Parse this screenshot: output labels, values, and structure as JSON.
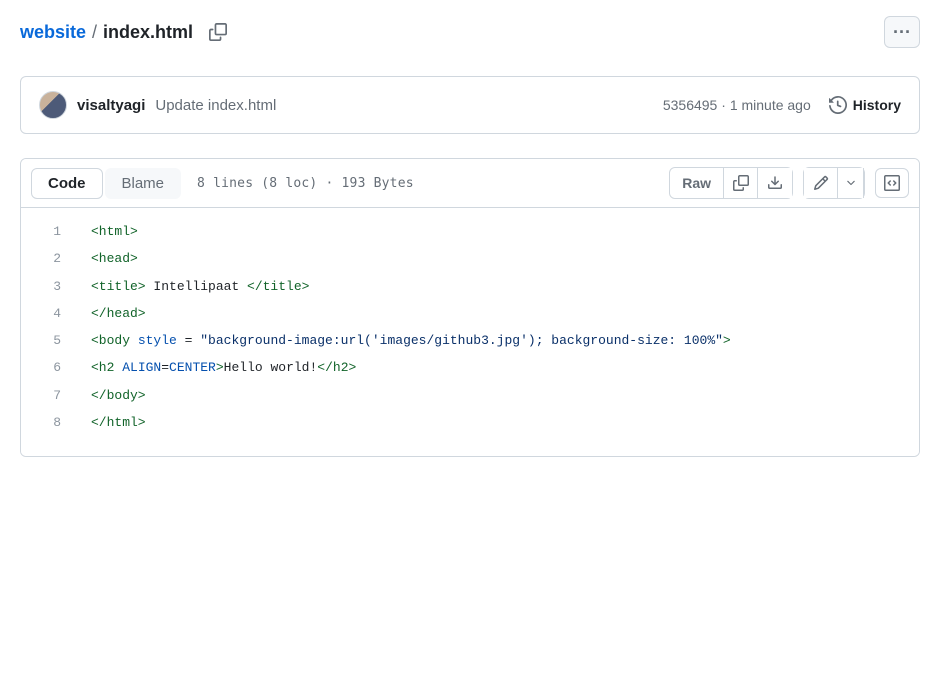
{
  "breadcrumb": {
    "dir": "website",
    "file": "index.html"
  },
  "commit": {
    "author": "visaltyagi",
    "message": "Update index.html",
    "sha": "5356495",
    "time": "1 minute ago",
    "history_label": "History"
  },
  "toolbar": {
    "code_label": "Code",
    "blame_label": "Blame",
    "stats": "8 lines (8 loc) · 193 Bytes",
    "raw_label": "Raw"
  },
  "code_lines": [
    {
      "n": "1",
      "tokens": [
        {
          "c": "pl-ent",
          "t": "<html>"
        }
      ]
    },
    {
      "n": "2",
      "tokens": [
        {
          "c": "pl-ent",
          "t": "<head>"
        }
      ]
    },
    {
      "n": "3",
      "tokens": [
        {
          "c": "pl-ent",
          "t": "<title>"
        },
        {
          "c": "",
          "t": " Intellipaat "
        },
        {
          "c": "pl-ent",
          "t": "</title>"
        }
      ]
    },
    {
      "n": "4",
      "tokens": [
        {
          "c": "pl-ent",
          "t": "</head>"
        }
      ]
    },
    {
      "n": "5",
      "tokens": [
        {
          "c": "pl-ent",
          "t": "<body "
        },
        {
          "c": "pl-e",
          "t": "style"
        },
        {
          "c": "",
          "t": " = "
        },
        {
          "c": "pl-s",
          "t": "\"background-image:url('images/github3.jpg'); background-size: 100%\""
        },
        {
          "c": "pl-ent",
          "t": ">"
        }
      ]
    },
    {
      "n": "6",
      "tokens": [
        {
          "c": "pl-ent",
          "t": "<h2 "
        },
        {
          "c": "pl-e",
          "t": "ALIGN"
        },
        {
          "c": "",
          "t": "="
        },
        {
          "c": "pl-e",
          "t": "CENTER"
        },
        {
          "c": "pl-ent",
          "t": ">"
        },
        {
          "c": "",
          "t": "Hello world!"
        },
        {
          "c": "pl-ent",
          "t": "</h2>"
        }
      ]
    },
    {
      "n": "7",
      "tokens": [
        {
          "c": "pl-ent",
          "t": "</body>"
        }
      ]
    },
    {
      "n": "8",
      "tokens": [
        {
          "c": "pl-ent",
          "t": "</html>"
        }
      ]
    }
  ]
}
